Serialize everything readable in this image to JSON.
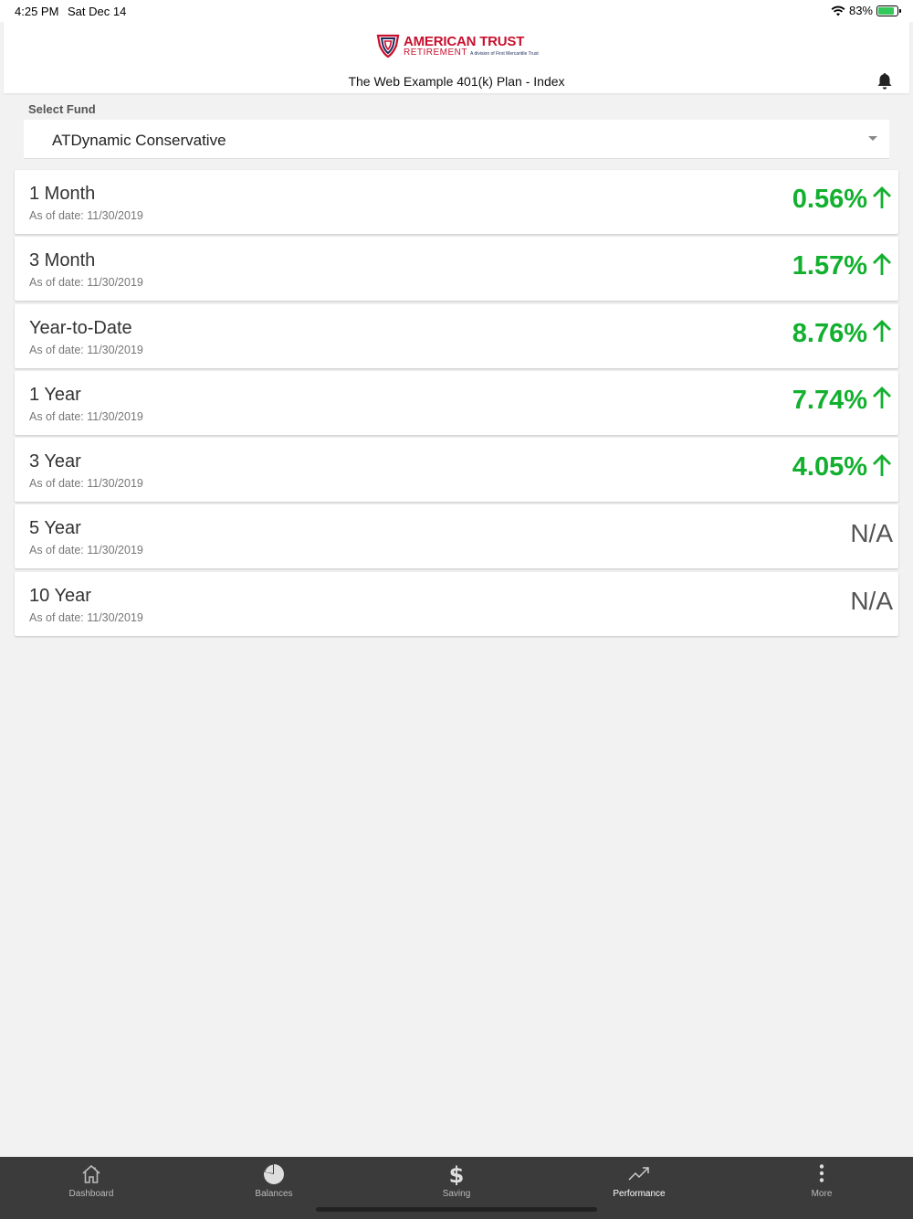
{
  "status_bar": {
    "time": "4:25 PM",
    "date": "Sat Dec 14",
    "battery": "83%"
  },
  "header": {
    "brand_main": "AMERICAN TRUST",
    "brand_sub": "RETIREMENT",
    "brand_division": "A division of First Mercantile Trust",
    "plan_title": "The Web Example 401(k) Plan - Index"
  },
  "fund_select": {
    "label": "Select Fund",
    "value": "ATDynamic Conservative"
  },
  "performance": [
    {
      "period": "1 Month",
      "as_of": "As of date: 11/30/2019",
      "value": "0.56%",
      "trend": "up"
    },
    {
      "period": "3 Month",
      "as_of": "As of date: 11/30/2019",
      "value": "1.57%",
      "trend": "up"
    },
    {
      "period": "Year-to-Date",
      "as_of": "As of date: 11/30/2019",
      "value": "8.76%",
      "trend": "up"
    },
    {
      "period": "1 Year",
      "as_of": "As of date: 11/30/2019",
      "value": "7.74%",
      "trend": "up"
    },
    {
      "period": "3 Year",
      "as_of": "As of date: 11/30/2019",
      "value": "4.05%",
      "trend": "up"
    },
    {
      "period": "5 Year",
      "as_of": "As of date: 11/30/2019",
      "value": "N/A",
      "trend": "none"
    },
    {
      "period": "10 Year",
      "as_of": "As of date: 11/30/2019",
      "value": "N/A",
      "trend": "none"
    }
  ],
  "tabs": [
    {
      "label": "Dashboard",
      "icon": "home-icon"
    },
    {
      "label": "Balances",
      "icon": "pie-chart-icon"
    },
    {
      "label": "Saving",
      "icon": "dollar-icon"
    },
    {
      "label": "Performance",
      "icon": "trending-up-icon",
      "active": true
    },
    {
      "label": "More",
      "icon": "more-vertical-icon"
    }
  ],
  "colors": {
    "brand_red": "#c8102e",
    "brand_navy": "#1c2b5a",
    "positive_green": "#12b02e",
    "tab_bar_bg": "#3b3b3b"
  }
}
